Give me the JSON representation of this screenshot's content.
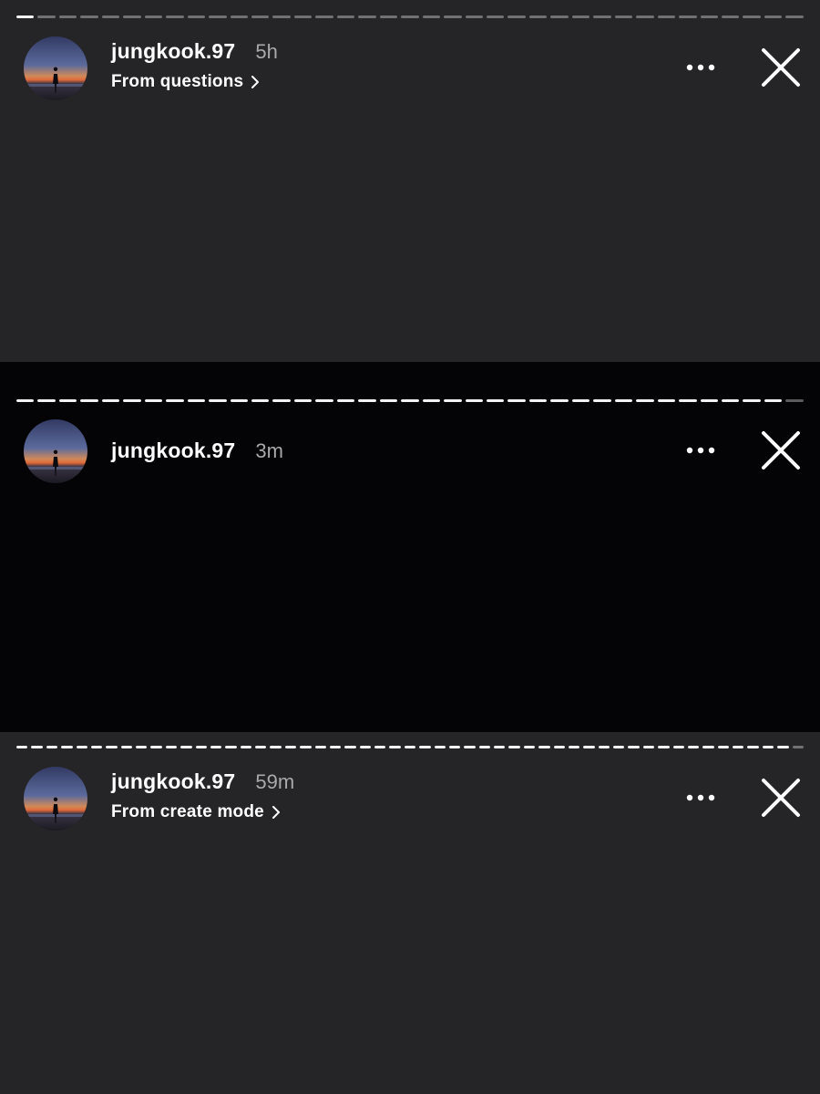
{
  "colors": {
    "panel_dark_gray": "#252427",
    "panel_black": "#040305",
    "progress_fill": "#ffffff",
    "secondary_text": "#a9a9ad"
  },
  "icons": {
    "more": "more-horizontal-icon",
    "close": "close-icon",
    "chevron": "chevron-right-icon"
  },
  "stories": [
    {
      "username": "jungkook.97",
      "time": "5h",
      "source": "From questions",
      "progress_segments": 37,
      "progress_filled": 1
    },
    {
      "username": "jungkook.97",
      "time": "3m",
      "source": "",
      "progress_segments": 37,
      "progress_filled": 36
    },
    {
      "username": "jungkook.97",
      "time": "59m",
      "source": "From create mode",
      "progress_segments": 53,
      "progress_filled": 52
    }
  ]
}
